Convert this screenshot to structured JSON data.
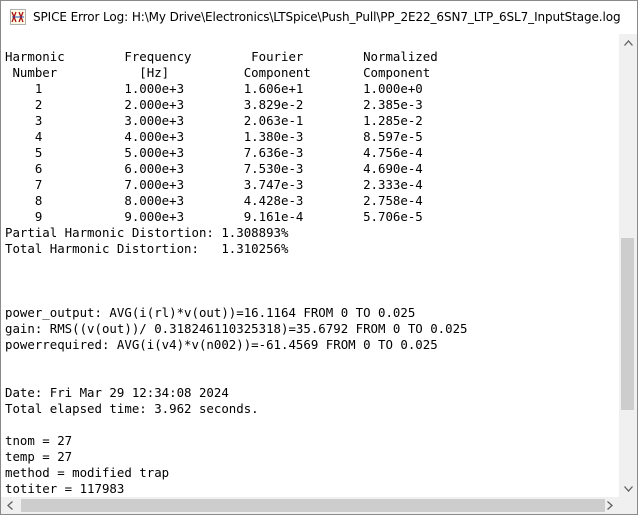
{
  "window": {
    "title": "SPICE Error Log: H:\\My Drive\\Electronics\\LTSpice\\Push_Pull\\PP_2E22_6SN7_LTP_6SL7_InputStage.log",
    "icon": "ltspice-app-icon"
  },
  "log": {
    "text": "Harmonic\tFrequency\t Fourier \tNormalized\n Number \t  [Hz]\t\tComponent\tComponent\n    1\t\t1.000e+3\t1.606e+1\t1.000e+0\n    2\t\t2.000e+3\t3.829e-2\t2.385e-3\n    3\t\t3.000e+3\t2.063e-1\t1.285e-2\n    4\t\t4.000e+3\t1.380e-3\t8.597e-5\n    5\t\t5.000e+3\t7.636e-3\t4.756e-4\n    6\t\t6.000e+3\t7.530e-3\t4.690e-4\n    7\t\t7.000e+3\t3.747e-3\t2.333e-4\n    8\t\t8.000e+3\t4.428e-3\t2.758e-4\n    9\t\t9.000e+3\t9.161e-4\t5.706e-5\nPartial Harmonic Distortion: 1.308893%\nTotal Harmonic Distortion:   1.310256%\n\n\n\npower_output: AVG(i(rl)*v(out))=16.1164 FROM 0 TO 0.025\ngain: RMS((v(out))/ 0.318246110325318)=35.6792 FROM 0 TO 0.025\npowerrequired: AVG(i(v4)*v(n002))=-61.4569 FROM 0 TO 0.025\n\n\nDate: Fri Mar 29 12:34:08 2024\nTotal elapsed time: 3.962 seconds.\n\ntnom = 27\ntemp = 27\nmethod = modified trap\ntotiter = 117983"
  },
  "scrollbars": {
    "vertical": {
      "position_fraction": 0.55,
      "visible_fraction": 0.37
    },
    "horizontal": {
      "position_fraction": 0.0,
      "visible_fraction": 0.99
    }
  }
}
